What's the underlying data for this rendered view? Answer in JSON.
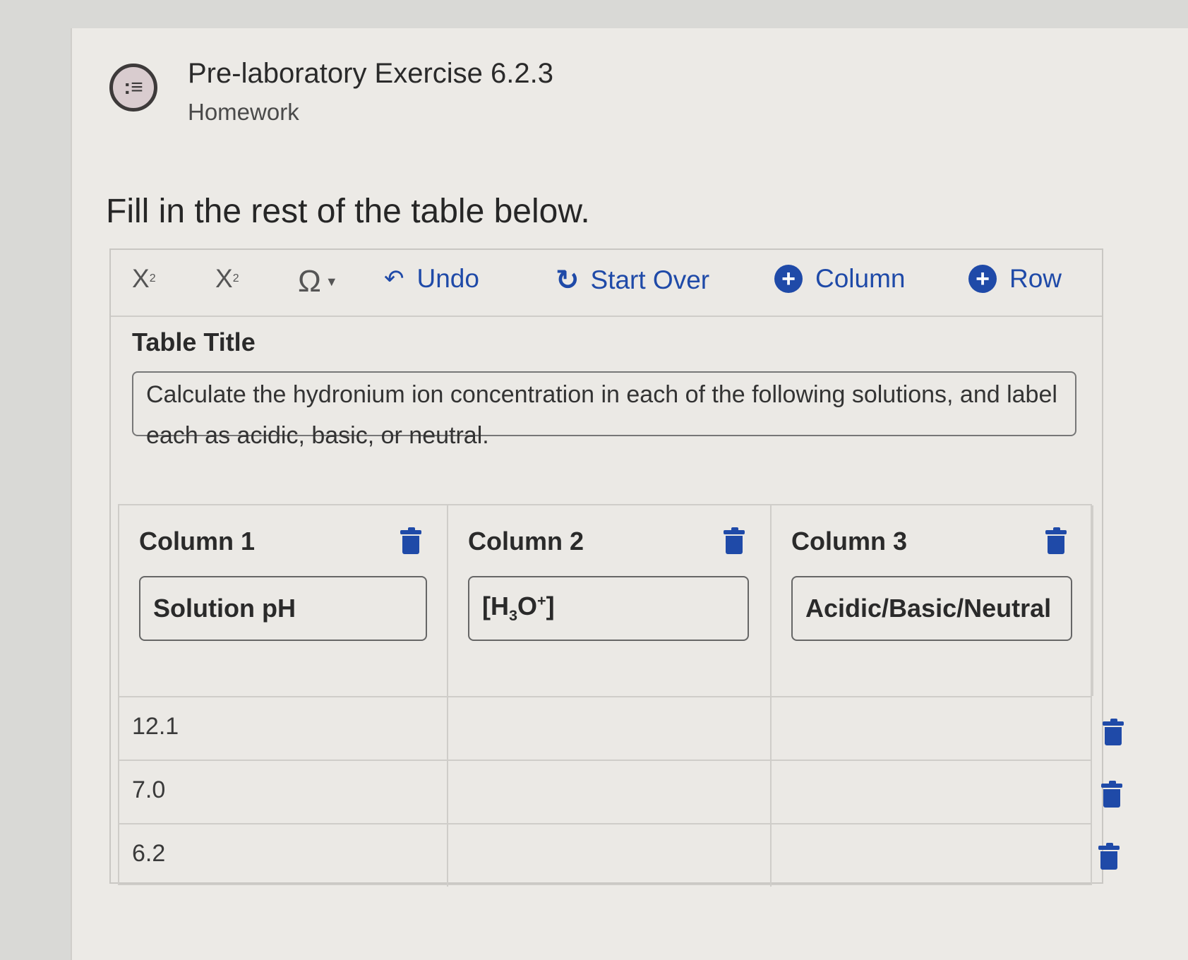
{
  "header": {
    "title": "Pre-laboratory Exercise 6.2.3",
    "subtitle": "Homework",
    "icon": "list-chat-icon"
  },
  "instruction": "Fill in the rest of the table below.",
  "toolbar": {
    "subscript_label": "X",
    "superscript_label": "X",
    "symbol_label": "Ω",
    "undo_label": "Undo",
    "start_over_label": "Start Over",
    "add_column_label": "Column",
    "add_row_label": "Row"
  },
  "table": {
    "title_label": "Table Title",
    "title_value": "Calculate the hydronium ion concentration in each of the following solutions, and label each as acidic, basic, or neutral.",
    "columns": [
      {
        "label": "Column 1",
        "header": "Solution pH"
      },
      {
        "label": "Column 2",
        "header": "[H3O+]"
      },
      {
        "label": "Column 3",
        "header": "Acidic/Basic/Neutral"
      }
    ],
    "rows": [
      [
        "12.1",
        "",
        ""
      ],
      [
        "7.0",
        "",
        ""
      ],
      [
        "6.2",
        "",
        ""
      ]
    ]
  },
  "colors": {
    "accent": "#1f4aa8",
    "background": "#eceae6"
  }
}
